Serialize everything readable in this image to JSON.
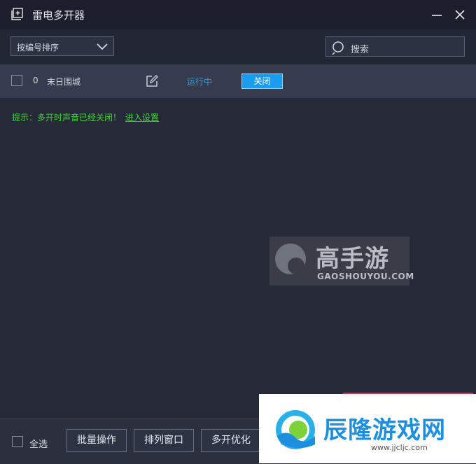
{
  "window": {
    "title": "雷电多开器"
  },
  "toolbar": {
    "sort_label": "按编号排序",
    "search_placeholder": "搜索"
  },
  "instances": [
    {
      "id": "0",
      "name": "末日围城",
      "status": "运行中",
      "action": "关闭"
    }
  ],
  "hint": {
    "text": "提示：多开时声音已经关闭！",
    "link": "进入设置"
  },
  "watermark": {
    "cn": "高手游",
    "en": "GAOSHOUYOU.COM"
  },
  "footer": {
    "select_all": "全选",
    "buttons": [
      "批量操作",
      "排列窗口",
      "多开优化"
    ]
  },
  "ad": {
    "cn": "辰隆游戏网",
    "url": "www.jjcljc.com"
  },
  "colors": {
    "accent": "#1a9df0",
    "status": "#2a9ee8",
    "hint": "#3fd42f",
    "bg": "#262a38"
  }
}
